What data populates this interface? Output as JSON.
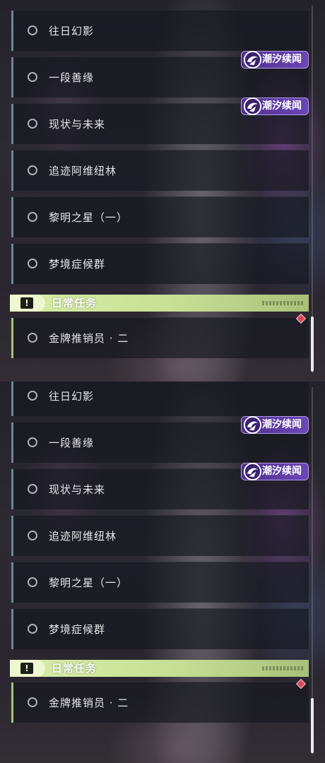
{
  "panels": [
    {
      "quests": [
        {
          "name": "往日幻影",
          "type": "main"
        },
        {
          "name": "一段善缘",
          "type": "main"
        },
        {
          "name": "现状与未来",
          "type": "main"
        },
        {
          "name": "追迹阿维纽林",
          "type": "main"
        },
        {
          "name": "黎明之星（一）",
          "type": "main"
        },
        {
          "name": "梦境症候群",
          "type": "main"
        }
      ],
      "tags": [
        {
          "label": "潮汐续闻"
        },
        {
          "label": "潮汐续闻"
        }
      ],
      "section": {
        "title": "日常任务",
        "icon": "exclamation-icon"
      },
      "daily_quests": [
        {
          "name": "金牌推销员 · 二",
          "marker": "red-diamond-icon"
        }
      ]
    },
    {
      "quests": [
        {
          "name": "往日幻影",
          "type": "main"
        },
        {
          "name": "一段善缘",
          "type": "main"
        },
        {
          "name": "现状与未来",
          "type": "main"
        },
        {
          "name": "追迹阿维纽林",
          "type": "main"
        },
        {
          "name": "黎明之星（一）",
          "type": "main"
        },
        {
          "name": "梦境症候群",
          "type": "main"
        }
      ],
      "tags": [
        {
          "label": "潮汐续闻"
        },
        {
          "label": "潮汐续闻"
        }
      ],
      "section": {
        "title": "日常任务",
        "icon": "exclamation-icon"
      },
      "daily_quests": [
        {
          "name": "金牌推销员 · 二",
          "marker": "red-diamond-icon"
        }
      ]
    }
  ],
  "colors": {
    "accent_main": "#6f8596",
    "accent_daily": "#a7c27b",
    "tag_purple": "#5b3aa3",
    "marker_red": "#d24b5a"
  }
}
